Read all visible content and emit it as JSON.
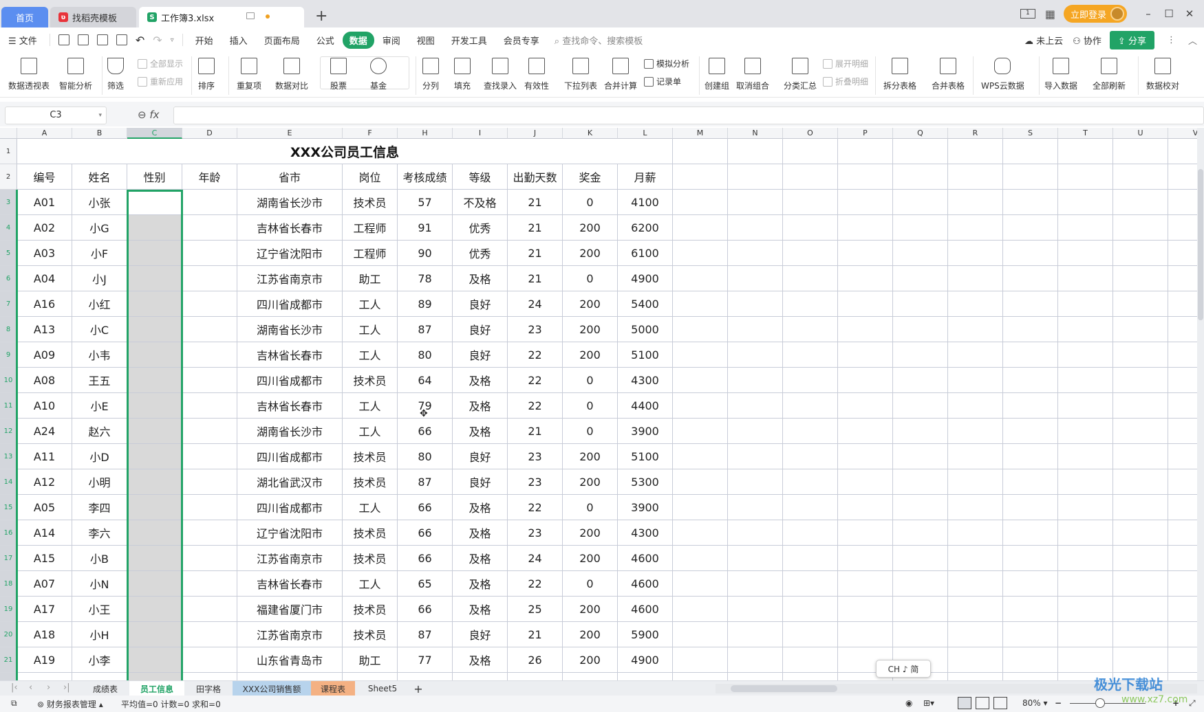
{
  "titlebar": {
    "tabs": [
      {
        "label": "首页",
        "active": false
      },
      {
        "label": "找稻壳模板",
        "active": false
      },
      {
        "label": "工作簿3.xlsx",
        "active": true
      }
    ],
    "new_tab": "+",
    "login_label": "立即登录",
    "win_min": "–",
    "win_max": "☐",
    "win_close": "✕",
    "colors": {
      "home_tab": "#5b8ef0",
      "login": "#f5a623",
      "accent": "#21a366"
    }
  },
  "menubar": {
    "file_label": "文件",
    "items": [
      "开始",
      "插入",
      "页面布局",
      "公式",
      "数据",
      "审阅",
      "视图",
      "开发工具",
      "会员专享"
    ],
    "active_item": "数据",
    "search_placeholder": "查找命令、搜索模板",
    "cloud_label": "未上云",
    "collab_label": "协作",
    "share_label": "分享"
  },
  "ribbon": {
    "pivot": "数据透视表",
    "smart": "智能分析",
    "filter": "筛选",
    "show_all": "全部显示",
    "reapply": "重新应用",
    "sort": "排序",
    "dup": "重复项",
    "compare": "数据对比",
    "stock": "股票",
    "fund": "基金",
    "split_col": "分列",
    "fill": "填充",
    "find_entry": "查找录入",
    "validity": "有效性",
    "dropdown": "下拉列表",
    "consolidate": "合并计算",
    "whatif": "模拟分析",
    "record": "记录单",
    "group": "创建组",
    "ungroup": "取消组合",
    "subtotal": "分类汇总",
    "expand": "展开明细",
    "collapse": "折叠明细",
    "split_table": "拆分表格",
    "merge_table": "合并表格",
    "wps_cloud": "WPS云数据",
    "import": "导入数据",
    "refresh_all": "全部刷新",
    "verify": "数据校对"
  },
  "formula_bar": {
    "name_box": "C3",
    "fx": "fx",
    "formula": ""
  },
  "sheet": {
    "columns": [
      "A",
      "B",
      "C",
      "D",
      "E",
      "F",
      "H",
      "I",
      "J",
      "K",
      "L",
      "M",
      "N",
      "O",
      "P",
      "Q",
      "R",
      "S",
      "T",
      "U",
      "V"
    ],
    "selected_column": "C",
    "title": "XXX公司员工信息",
    "headers": [
      "编号",
      "姓名",
      "性别",
      "年龄",
      "省市",
      "岗位",
      "考核成绩",
      "等级",
      "出勤天数",
      "奖金",
      "月薪"
    ],
    "rows": [
      [
        "A01",
        "小张",
        "",
        "",
        "湖南省长沙市",
        "技术员",
        "57",
        "不及格",
        "21",
        "0",
        "4100"
      ],
      [
        "A02",
        "小G",
        "",
        "",
        "吉林省长春市",
        "工程师",
        "91",
        "优秀",
        "21",
        "200",
        "6200"
      ],
      [
        "A03",
        "小F",
        "",
        "",
        "辽宁省沈阳市",
        "工程师",
        "90",
        "优秀",
        "21",
        "200",
        "6100"
      ],
      [
        "A04",
        "小J",
        "",
        "",
        "江苏省南京市",
        "助工",
        "78",
        "及格",
        "21",
        "0",
        "4900"
      ],
      [
        "A16",
        "小红",
        "",
        "",
        "四川省成都市",
        "工人",
        "89",
        "良好",
        "24",
        "200",
        "5400"
      ],
      [
        "A13",
        "小C",
        "",
        "",
        "湖南省长沙市",
        "工人",
        "87",
        "良好",
        "23",
        "200",
        "5000"
      ],
      [
        "A09",
        "小韦",
        "",
        "",
        "吉林省长春市",
        "工人",
        "80",
        "良好",
        "22",
        "200",
        "5100"
      ],
      [
        "A08",
        "王五",
        "",
        "",
        "四川省成都市",
        "技术员",
        "64",
        "及格",
        "22",
        "0",
        "4300"
      ],
      [
        "A10",
        "小E",
        "",
        "",
        "吉林省长春市",
        "工人",
        "79",
        "及格",
        "22",
        "0",
        "4400"
      ],
      [
        "A24",
        "赵六",
        "",
        "",
        "湖南省长沙市",
        "工人",
        "66",
        "及格",
        "21",
        "0",
        "3900"
      ],
      [
        "A11",
        "小D",
        "",
        "",
        "四川省成都市",
        "技术员",
        "80",
        "良好",
        "23",
        "200",
        "5100"
      ],
      [
        "A12",
        "小明",
        "",
        "",
        "湖北省武汉市",
        "技术员",
        "87",
        "良好",
        "23",
        "200",
        "5300"
      ],
      [
        "A05",
        "李四",
        "",
        "",
        "四川省成都市",
        "工人",
        "66",
        "及格",
        "22",
        "0",
        "3900"
      ],
      [
        "A14",
        "李六",
        "",
        "",
        "辽宁省沈阳市",
        "技术员",
        "66",
        "及格",
        "23",
        "200",
        "4300"
      ],
      [
        "A15",
        "小B",
        "",
        "",
        "江苏省南京市",
        "技术员",
        "66",
        "及格",
        "24",
        "200",
        "4600"
      ],
      [
        "A07",
        "小N",
        "",
        "",
        "吉林省长春市",
        "工人",
        "65",
        "及格",
        "22",
        "0",
        "4600"
      ],
      [
        "A17",
        "小王",
        "",
        "",
        "福建省厦门市",
        "技术员",
        "66",
        "及格",
        "25",
        "200",
        "4600"
      ],
      [
        "A18",
        "小H",
        "",
        "",
        "江苏省南京市",
        "技术员",
        "87",
        "良好",
        "21",
        "200",
        "5900"
      ],
      [
        "A19",
        "小李",
        "",
        "",
        "山东省青岛市",
        "助工",
        "77",
        "及格",
        "26",
        "200",
        "4900"
      ]
    ]
  },
  "ime_indicator": "CH ♪ 简",
  "sheet_tabs": [
    {
      "label": "成绩表",
      "color": ""
    },
    {
      "label": "员工信息",
      "color": "",
      "active": true
    },
    {
      "label": "田字格",
      "color": ""
    },
    {
      "label": "XXX公司销售额",
      "color": "#b7d3ec"
    },
    {
      "label": "课程表",
      "color": "#f4b183"
    },
    {
      "label": "Sheet5",
      "color": ""
    }
  ],
  "add_sheet": "+",
  "statusbar": {
    "report_mgr": "财务报表管理",
    "stats": "平均值=0  计数=0  求和=0",
    "zoom": "80%",
    "zoom_fraction": 0.4
  },
  "watermark": {
    "line1": "极光下载站",
    "line2": "www.xz7.com"
  }
}
